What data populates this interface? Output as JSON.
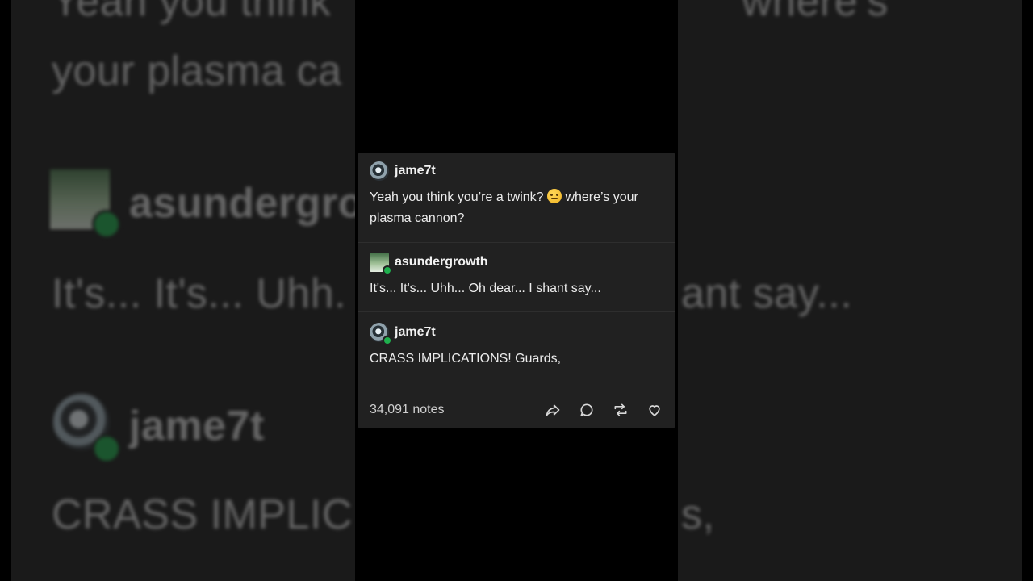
{
  "post": {
    "entries": [
      {
        "username": "jame7t",
        "text_before_emoji": "Yeah you think you’re a twink? ",
        "text_after_emoji": " where’s your plasma cannon?",
        "emoji_name": "raised-eyebrow-emoji"
      },
      {
        "username": "asundergrowth",
        "text": "It's... It's... Uhh... Oh dear... I shant say..."
      },
      {
        "username": "jame7t",
        "text": "CRASS IMPLICATIONS! Guards,"
      }
    ],
    "notes_count": "34,091 notes",
    "actions": [
      "share-icon",
      "reply-icon",
      "reblog-icon",
      "like-icon"
    ]
  },
  "background": {
    "line1": "Yeah you think",
    "line1b": "where’s",
    "line2": "your plasma ca",
    "name1": "asundergro",
    "line3": "It's... It's... Uhh.",
    "line3b": "ant say...",
    "name2": "jame7t",
    "line4": "CRASS IMPLIC",
    "line4b": "s,"
  },
  "colors": {
    "card_bg": "#212121",
    "badge_green": "#1fb14e"
  }
}
